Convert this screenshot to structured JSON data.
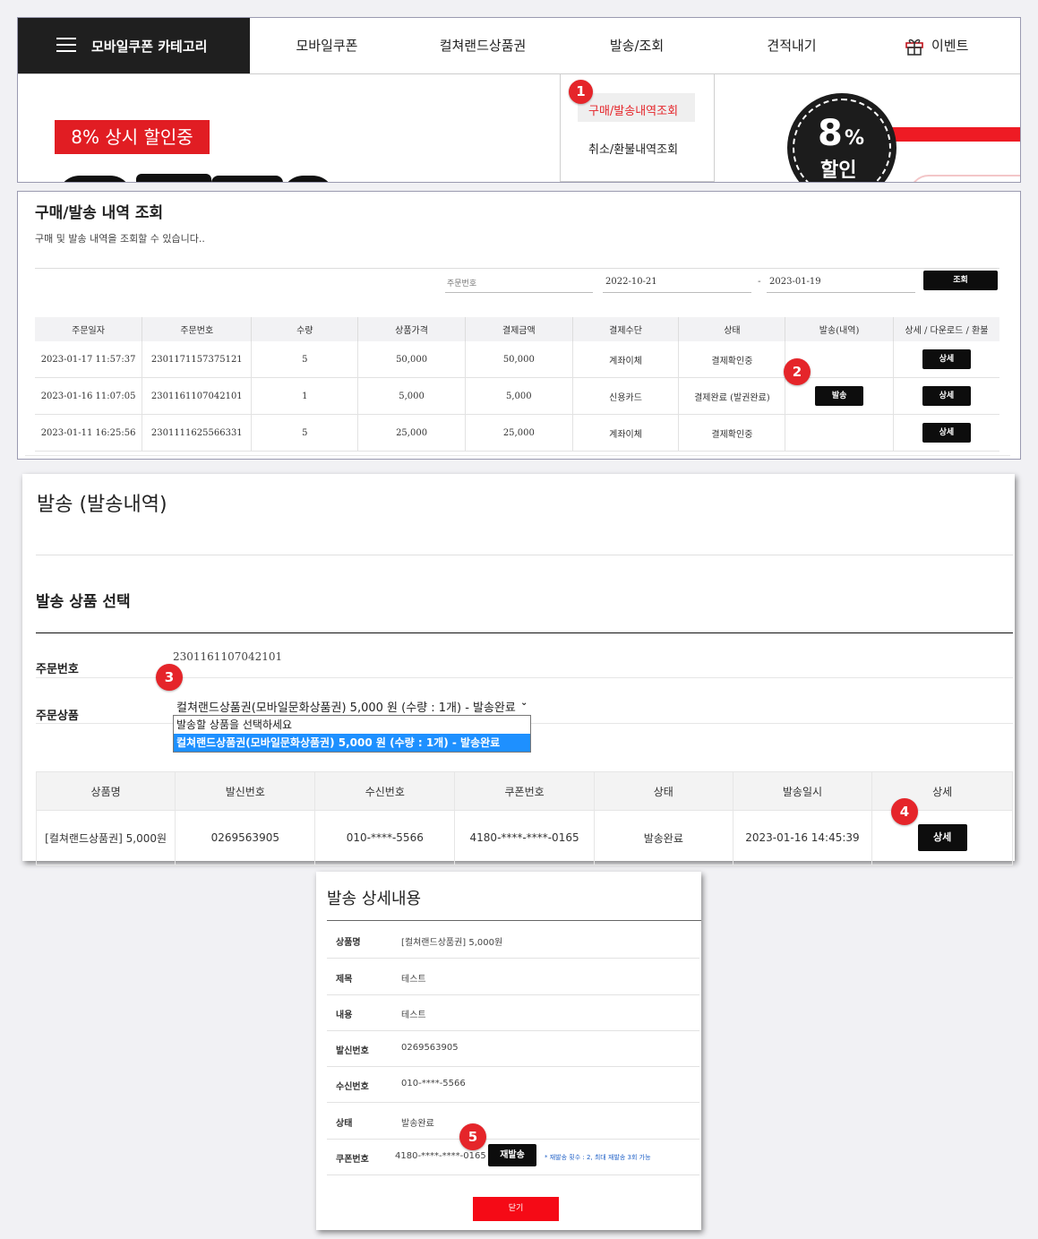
{
  "nav": {
    "category_label": "모바일쿠폰 카테고리",
    "items": [
      "모바일쿠폰",
      "컬쳐랜드상품권",
      "발송/조회",
      "견적내기",
      "이벤트"
    ],
    "dropdown": [
      "구매/발송내역조회",
      "취소/환불내역조회"
    ]
  },
  "banner": {
    "tag": "8% 상시 할인중",
    "circle_big": "8",
    "circle_pct": "%",
    "circle_sub": "할인"
  },
  "orders": {
    "title": "구매/발송 내역 조회",
    "subtitle": "구매 및 발송 내역을 조회할 수 있습니다..",
    "search": {
      "order_no_placeholder": "주문번호",
      "date_from": "2022-10-21",
      "date_sep": "-",
      "date_to": "2023-01-19",
      "button": "조회"
    },
    "columns": [
      "주문일자",
      "주문번호",
      "수량",
      "상품가격",
      "결제금액",
      "결제수단",
      "상태",
      "발송(내역)",
      "상세 / 다운로드 / 환불"
    ],
    "rows": [
      {
        "date": "2023-01-17 11:57:37",
        "no": "2301171157375121",
        "qty": "5",
        "price": "50,000",
        "paid": "50,000",
        "method": "계좌이체",
        "status": "결제확인중",
        "send": "",
        "detail": "상세"
      },
      {
        "date": "2023-01-16 11:07:05",
        "no": "2301161107042101",
        "qty": "1",
        "price": "5,000",
        "paid": "5,000",
        "method": "신용카드",
        "status": "결제완료 (발권완료)",
        "send": "발송",
        "detail": "상세"
      },
      {
        "date": "2023-01-11 16:25:56",
        "no": "2301111625566331",
        "qty": "5",
        "price": "25,000",
        "paid": "25,000",
        "method": "계좌이체",
        "status": "결제확인중",
        "send": "",
        "detail": "상세"
      }
    ]
  },
  "send": {
    "title": "발송 (발송내역)",
    "section": "발송 상품 선택",
    "order_no_label": "주문번호",
    "order_no": "2301161107042101",
    "product_label": "주문상품",
    "selected": "컬쳐랜드상품권(모바일문화상품권)   5,000 원 (수량 : 1개) - 발송완료",
    "options": [
      "발송할 상품을 선택하세요",
      "컬쳐랜드상품권(모바일문화상품권)   5,000 원 (수량 : 1개) - 발송완료"
    ],
    "columns": [
      "상품명",
      "발신번호",
      "수신번호",
      "쿠폰번호",
      "상태",
      "발송일시",
      "상세"
    ],
    "row": {
      "name": "[컬쳐랜드상품권] 5,000원",
      "from": "0269563905",
      "to": "010-****-5566",
      "coupon": "4180-****-****-0165",
      "status": "발송완료",
      "sent_at": "2023-01-16 14:45:39",
      "detail": "상세"
    }
  },
  "detail": {
    "title": "발송 상세내용",
    "rows": [
      {
        "label": "상품명",
        "value": "[컬쳐랜드상품권] 5,000원"
      },
      {
        "label": "제목",
        "value": "테스트"
      },
      {
        "label": "내용",
        "value": "테스트"
      },
      {
        "label": "발신번호",
        "value": "0269563905"
      },
      {
        "label": "수신번호",
        "value": "010-****-5566"
      },
      {
        "label": "상태",
        "value": "발송완료"
      }
    ],
    "coupon_label": "쿠폰번호",
    "coupon_value": "4180-****-****-0165",
    "resend": "재발송",
    "note": "* 재발송 횟수 : 2, 최대 재발송 3회 가능",
    "close": "닫기"
  },
  "badges": [
    "1",
    "2",
    "3",
    "4",
    "5"
  ],
  "colors": {
    "accent": "#e5252a",
    "dark": "#1f1f1f",
    "select_blue": "#1e90ff"
  }
}
